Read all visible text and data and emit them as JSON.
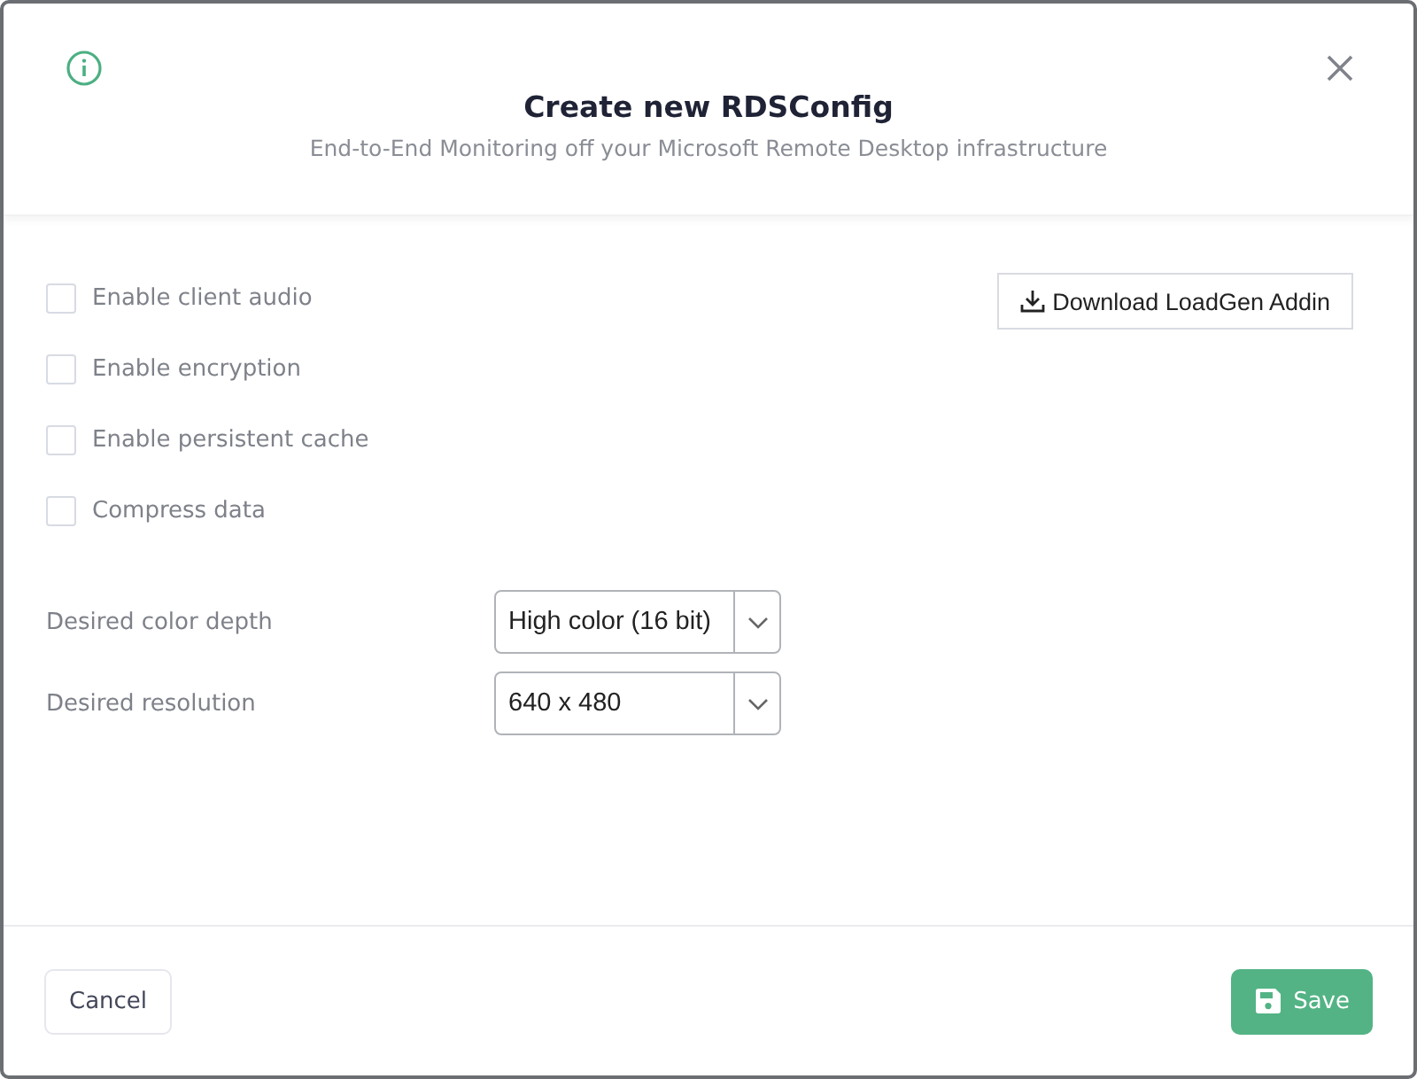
{
  "dialog": {
    "title": "Create new RDSConfig",
    "subtitle": "End-to-End Monitoring off your Microsoft Remote Desktop infrastructure"
  },
  "options": [
    {
      "label": "Enable client audio",
      "checked": false
    },
    {
      "label": "Enable encryption",
      "checked": false
    },
    {
      "label": "Enable persistent cache",
      "checked": false
    },
    {
      "label": "Compress data",
      "checked": false
    }
  ],
  "download_button": "Download LoadGen Addin",
  "selects": [
    {
      "label": "Desired color depth",
      "value": "High color (16 bit)"
    },
    {
      "label": "Desired resolution",
      "value": "640 x 480"
    }
  ],
  "footer": {
    "cancel": "Cancel",
    "save": "Save"
  }
}
